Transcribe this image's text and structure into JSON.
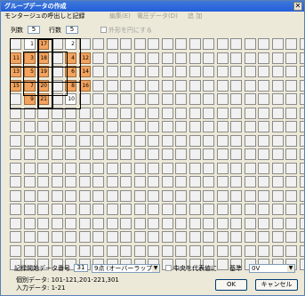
{
  "window": {
    "title": "グループデータの作成",
    "close_glyph": "✕"
  },
  "menu": [
    {
      "label": "モンタージュの呼出しと記録",
      "disabled": false
    },
    {
      "label": "編集(E)",
      "disabled": true
    },
    {
      "label": "電圧データ(D)",
      "disabled": true
    },
    {
      "label": "追 加",
      "disabled": true
    }
  ],
  "controls": {
    "cols_label": "列数",
    "cols_value": "5",
    "rows_label": "行数",
    "rows_value": "5",
    "outside_label": "外形を円にする"
  },
  "grid": {
    "rows": 17,
    "cols": 22,
    "cells": [
      {
        "r": 0,
        "c": 1,
        "text": "1",
        "orange": false
      },
      {
        "r": 0,
        "c": 2,
        "text": "17",
        "orange": true
      },
      {
        "r": 0,
        "c": 4,
        "text": "2",
        "orange": false
      },
      {
        "r": 1,
        "c": 0,
        "text": "11",
        "orange": true
      },
      {
        "r": 1,
        "c": 1,
        "text": "3",
        "orange": true
      },
      {
        "r": 1,
        "c": 2,
        "text": "18",
        "orange": true
      },
      {
        "r": 1,
        "c": 4,
        "text": "4",
        "orange": true
      },
      {
        "r": 1,
        "c": 5,
        "text": "12",
        "orange": true
      },
      {
        "r": 2,
        "c": 0,
        "text": "13",
        "orange": true
      },
      {
        "r": 2,
        "c": 1,
        "text": "5",
        "orange": true
      },
      {
        "r": 2,
        "c": 2,
        "text": "19",
        "orange": true
      },
      {
        "r": 2,
        "c": 4,
        "text": "6",
        "orange": true
      },
      {
        "r": 2,
        "c": 5,
        "text": "14",
        "orange": true
      },
      {
        "r": 3,
        "c": 0,
        "text": "15",
        "orange": true
      },
      {
        "r": 3,
        "c": 1,
        "text": "7",
        "orange": true
      },
      {
        "r": 3,
        "c": 2,
        "text": "20",
        "orange": true
      },
      {
        "r": 3,
        "c": 4,
        "text": "8",
        "orange": true
      },
      {
        "r": 3,
        "c": 5,
        "text": "16",
        "orange": true
      },
      {
        "r": 4,
        "c": 1,
        "text": "9",
        "orange": true
      },
      {
        "r": 4,
        "c": 2,
        "text": "21",
        "orange": true
      },
      {
        "r": 4,
        "c": 4,
        "text": "10",
        "orange": false
      }
    ]
  },
  "bottom": {
    "start_label": "記録開始データ番号",
    "start_value": "31",
    "mode_value": "9点 (オーバーラップ)",
    "center_label": "中央を代表値に",
    "ref_label": "基準",
    "ref_value": "0V",
    "info1": "個別データ: 101-121,201-221,301",
    "info2": "入力データ: 1-21",
    "ok": "OK",
    "cancel": "キャンセル"
  }
}
